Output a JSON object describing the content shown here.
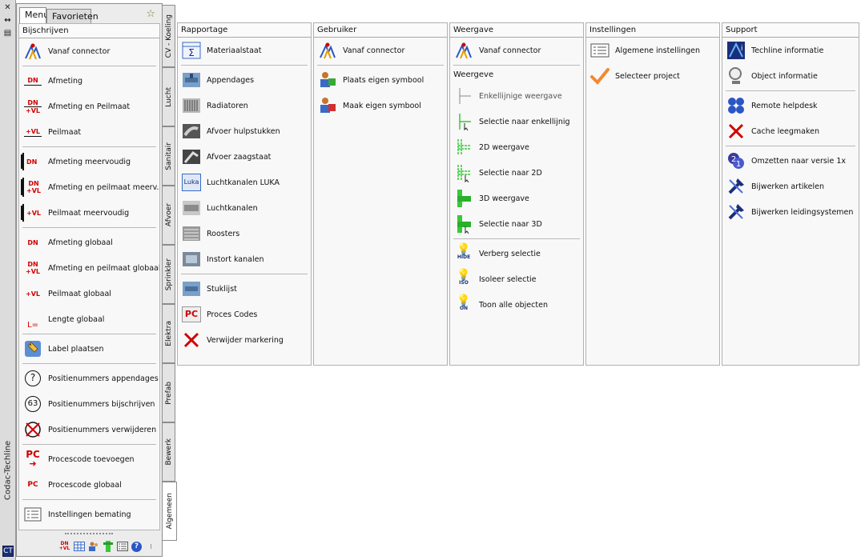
{
  "strip": {
    "close": "✕",
    "dock": "↔",
    "menu": "▤",
    "title": "Codac-Techline",
    "logo": "CT"
  },
  "palette": {
    "tabs": [
      {
        "label": "Menu",
        "active": true
      },
      {
        "label": "Favorieten",
        "active": false
      }
    ],
    "section_title": "Bijschrijven",
    "items": [
      {
        "label": "Vanaf connector",
        "icon": "connector-icon"
      },
      {
        "label": "Afmeting",
        "icon": "dn-icon"
      },
      {
        "label": "Afmeting en Peilmaat",
        "icon": "dn-vl-icon"
      },
      {
        "label": "Peilmaat",
        "icon": "vl-icon"
      },
      {
        "label": "Afmeting meervoudig",
        "icon": "dn-multi-icon"
      },
      {
        "label": "Afmeting en peilmaat meerv.",
        "icon": "dn-vl-multi-icon"
      },
      {
        "label": "Peilmaat meervoudig",
        "icon": "vl-multi-icon"
      },
      {
        "label": "Afmeting globaal",
        "icon": "dn-global-icon"
      },
      {
        "label": "Afmeting en peilmaat globaal",
        "icon": "dn-vl-global-icon"
      },
      {
        "label": "Peilmaat globaal",
        "icon": "vl-global-icon"
      },
      {
        "label": "Lengte globaal",
        "icon": "length-icon"
      },
      {
        "label": "Label plaatsen",
        "icon": "label-icon"
      },
      {
        "label": "Positienummers appendages",
        "icon": "question-circle-icon"
      },
      {
        "label": "Positienummers bijschrijven",
        "icon": "number-circle-icon"
      },
      {
        "label": "Positienummers verwijderen",
        "icon": "remove-circle-icon"
      },
      {
        "label": "Procescode toevoegen",
        "icon": "pc-add-icon"
      },
      {
        "label": "Procescode globaal",
        "icon": "pc-global-icon"
      },
      {
        "label": "Instellingen bemating",
        "icon": "settings-list-icon"
      }
    ],
    "icon_text": {
      "dn": "DN",
      "vl": "+VL",
      "dnvl_top": "DN",
      "dnvl_bot": "+VL",
      "l": "L=",
      "q": "?",
      "n": "63",
      "pc": "PC"
    }
  },
  "vtabs": [
    {
      "label": "CV - Koeling"
    },
    {
      "label": "Lucht"
    },
    {
      "label": "Sanitair"
    },
    {
      "label": "Afvoer"
    },
    {
      "label": "Sprinkler"
    },
    {
      "label": "Elektra"
    },
    {
      "label": "Prefab"
    },
    {
      "label": "Bewerk"
    },
    {
      "label": "Algemeen"
    }
  ],
  "columns": {
    "rapportage": {
      "title": "Rapportage",
      "items": [
        "Materiaalstaat",
        "Appendages",
        "Radiatoren",
        "Afvoer hulpstukken",
        "Afvoer zaagstaat",
        "Luchtkanalen LUKA",
        "Luchtkanalen",
        "Roosters",
        "Instort kanalen",
        "Stuklijst",
        "Proces Codes",
        "Verwijder markering"
      ],
      "icon_text": {
        "sigma": "Σ",
        "luka": "Luka",
        "pc": "PC"
      }
    },
    "gebruiker": {
      "title": "Gebruiker",
      "items": [
        "Vanaf connector",
        "Plaats eigen symbool",
        "Maak eigen symbool"
      ]
    },
    "weergave": {
      "title": "Weergave",
      "top_item": "Vanaf connector",
      "sub_title": "Weergeve",
      "items": [
        "Enkellijnige weergave",
        "Selectie naar enkellijnig",
        "2D weergave",
        "Selectie naar 2D",
        "3D weergave",
        "Selectie naar 3D"
      ],
      "items2": [
        "Verberg selectie",
        "Isoleer selectie",
        "Toon alle objecten"
      ],
      "icon_text": {
        "hide": "HIDE",
        "iso": "ISO",
        "on": "ON"
      }
    },
    "instellingen": {
      "title": "Instellingen",
      "items": [
        "Algemene instellingen",
        "Selecteer project"
      ]
    },
    "support": {
      "title": "Support",
      "items": [
        "Techline informatie",
        "Object informatie",
        "Remote helpdesk",
        "Cache leegmaken",
        "Omzetten naar versie 1x",
        "Bijwerken artikelen",
        "Bijwerken leidingsystemen"
      ]
    }
  },
  "toolbar": {
    "dnvl_top": "DN",
    "dnvl_bot": "+VL",
    "help": "?",
    "more": "⁝"
  },
  "colors": {
    "red": "#d00000",
    "blue": "#2a56c6",
    "green": "#38c838",
    "border": "#8c8c8c"
  }
}
